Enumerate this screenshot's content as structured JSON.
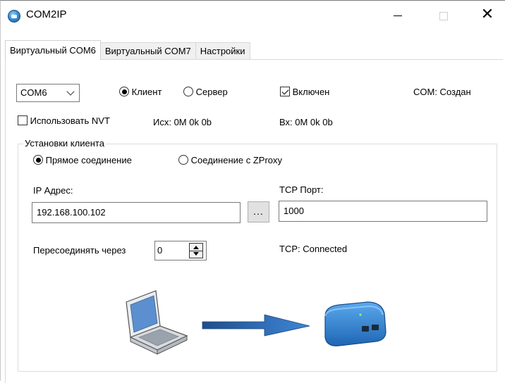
{
  "window": {
    "title": "COM2IP"
  },
  "tabs": [
    {
      "label": "Виртуальный COM6",
      "active": true
    },
    {
      "label": "Виртуальный COM7",
      "active": false
    },
    {
      "label": "Настройки",
      "active": false
    }
  ],
  "port": {
    "selected": "COM6",
    "mode_client_label": "Клиент",
    "mode_server_label": "Сервер",
    "mode_selected": "client",
    "enabled_label": "Включен",
    "enabled_checked": true,
    "com_status": "COM: Создан",
    "nvt_label": "Использовать NVT",
    "nvt_checked": false,
    "out_stats": "Исх:  0M 0k 0b",
    "in_stats": "Вх:  0M 0k 0b"
  },
  "client_settings": {
    "legend": "Установки клиента",
    "direct_label": "Прямое соединение",
    "zproxy_label": "Соединение с ZProxy",
    "connection_selected": "direct",
    "ip_label": "IP Адрес:",
    "ip_value": "192.168.100.102",
    "browse_label": "...",
    "tcp_port_label": "TCP Порт:",
    "tcp_port_value": "1000",
    "reconnect_label": "Пересоединять через",
    "reconnect_value": "0",
    "tcp_status": "TCP: Connected"
  },
  "icons": {
    "app": "app-icon",
    "computer": "laptop-computer-icon",
    "arrow": "arrow-right-icon",
    "device": "converter-device-icon"
  },
  "colors": {
    "arrow_blue": "#2f6fb5",
    "device_blue": "#2d7fd1"
  }
}
